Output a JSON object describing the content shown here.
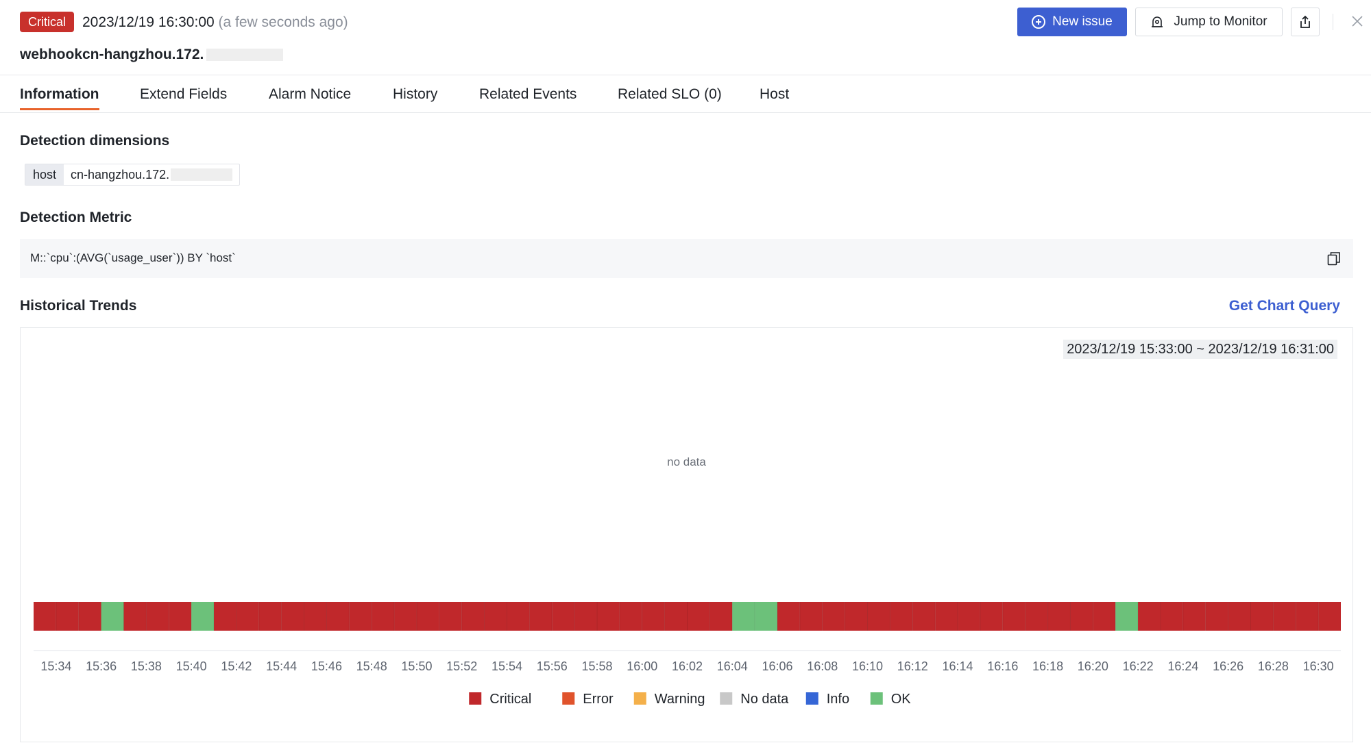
{
  "header": {
    "severity": "Critical",
    "time": "2023/12/19 16:30:00",
    "ago": "(a few seconds ago)",
    "title": "webhookcn-hangzhou.172.",
    "new_issue_label": "New issue",
    "jump_label": "Jump to Monitor"
  },
  "tabs": [
    {
      "label": "Information",
      "active": true
    },
    {
      "label": "Extend Fields"
    },
    {
      "label": "Alarm Notice"
    },
    {
      "label": "History"
    },
    {
      "label": "Related Events"
    },
    {
      "label": "Related SLO (0)"
    },
    {
      "label": "Host"
    }
  ],
  "detection_dimensions": {
    "title": "Detection dimensions",
    "key": "host",
    "value": "cn-hangzhou.172."
  },
  "detection_metric": {
    "title": "Detection Metric",
    "query": "M::`cpu`:(AVG(`usage_user`)) BY `host`"
  },
  "historical_trends": {
    "title": "Historical Trends",
    "get_chart_query_label": "Get Chart Query",
    "range": "2023/12/19 15:33:00 ~ 2023/12/19 16:31:00",
    "no_data": "no data"
  },
  "colors": {
    "accent": "#3d5fd1",
    "critical": "#c0282b",
    "error": "#e0532c",
    "warning": "#f4b04a",
    "nodata": "#c8c8c8",
    "info": "#3566d6",
    "ok": "#6cc17a",
    "tab_underline": "#e8632b"
  },
  "chart_data": {
    "type": "heatmap",
    "x_ticks": [
      "15:34",
      "15:36",
      "15:38",
      "15:40",
      "15:42",
      "15:44",
      "15:46",
      "15:48",
      "15:50",
      "15:52",
      "15:54",
      "15:56",
      "15:58",
      "16:00",
      "16:02",
      "16:04",
      "16:06",
      "16:08",
      "16:10",
      "16:12",
      "16:14",
      "16:16",
      "16:18",
      "16:20",
      "16:22",
      "16:24",
      "16:26",
      "16:28",
      "16:30"
    ],
    "status_segments": [
      {
        "from": "15:33",
        "to": "15:36",
        "status": "Critical"
      },
      {
        "from": "15:36",
        "to": "15:37",
        "status": "OK"
      },
      {
        "from": "15:37",
        "to": "15:40",
        "status": "Critical"
      },
      {
        "from": "15:40",
        "to": "15:41",
        "status": "OK"
      },
      {
        "from": "15:41",
        "to": "16:04",
        "status": "Critical"
      },
      {
        "from": "16:04",
        "to": "16:06",
        "status": "OK"
      },
      {
        "from": "16:06",
        "to": "16:21",
        "status": "Critical"
      },
      {
        "from": "16:21",
        "to": "16:22",
        "status": "OK"
      },
      {
        "from": "16:22",
        "to": "16:31",
        "status": "Critical"
      }
    ],
    "legend": [
      {
        "name": "Critical",
        "color": "#c0282b"
      },
      {
        "name": "Error",
        "color": "#e0532c"
      },
      {
        "name": "Warning",
        "color": "#f4b04a"
      },
      {
        "name": "No data",
        "color": "#c8c8c8"
      },
      {
        "name": "Info",
        "color": "#3566d6"
      },
      {
        "name": "OK",
        "color": "#6cc17a"
      }
    ]
  }
}
